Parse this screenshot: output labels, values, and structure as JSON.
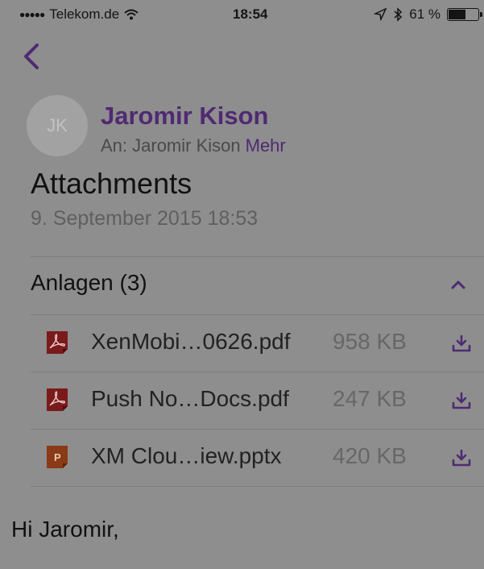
{
  "status_bar": {
    "signal_dots": "●●●●●",
    "carrier": "Telekom.de",
    "time": "18:54",
    "battery_text": "61 %",
    "battery_level": 0.61,
    "icons": [
      "wifi-icon",
      "location-icon",
      "bluetooth-icon",
      "battery-icon"
    ]
  },
  "nav": {
    "back_icon": "chevron-left-icon"
  },
  "email": {
    "avatar_initials": "JK",
    "sender": "Jaromir Kison",
    "to_label": "An: Jaromir Kison",
    "more_label": "Mehr",
    "subject": "Attachments",
    "date": "9. September 2015 18:53"
  },
  "attachments": {
    "header": "Anlagen (3)",
    "items": [
      {
        "name": "XenMobi…0626.pdf",
        "size": "958 KB",
        "type": "pdf"
      },
      {
        "name": "Push No…Docs.pdf",
        "size": "247 KB",
        "type": "pdf"
      },
      {
        "name": "XM Clou…iew.pptx",
        "size": "420 KB",
        "type": "pptx"
      }
    ]
  },
  "body": {
    "greeting": "Hi Jaromir,"
  },
  "colors": {
    "accent": "#4f2a72",
    "overlay_background": "#8e8e8e",
    "pdf_icon": "#7a1a1a",
    "pptx_icon": "#8a3a14"
  }
}
